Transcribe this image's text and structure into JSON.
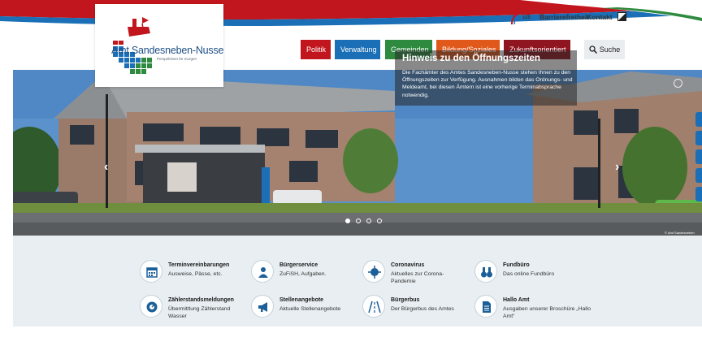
{
  "header": {
    "logo": {
      "name": "Amt Sandesneben-Nusse",
      "tagline": "Perspektiven für morgen"
    },
    "utility": {
      "counter": "115",
      "accessibility": "Barrierefreiheit",
      "contact": "Kontakt"
    },
    "nav": [
      {
        "label": "Politik",
        "color": "#c2161e"
      },
      {
        "label": "Verwaltung",
        "color": "#1b6fb6"
      },
      {
        "label": "Gemeinden",
        "color": "#2e8a3f"
      },
      {
        "label": "Bildung/Soziales",
        "color": "#e1581b"
      },
      {
        "label": "Zukunftsorientiert",
        "color": "#8f1520"
      }
    ],
    "search_label": "Suche"
  },
  "hero": {
    "title": "Hinweis zu den Öffnungszeiten",
    "text": "Die Fachämter des Amtes Sandesneben-Nusse stehen Ihnen zu den Öffnungszeiten zur Verfügung. Ausnahmen bilden das Ordnungs- und Meldeamt, bei diesen Ämtern ist eine vorherige Terminabsprache notwendig.",
    "slides": 4,
    "active_slide": 1,
    "copyright": "© Amt Sandesneben"
  },
  "quick_links": [
    {
      "title": "Terminvereinbarungen",
      "sub": "Ausweise, Pässe, etc.",
      "icon": "calendar-icon"
    },
    {
      "title": "Bürgerservice",
      "sub": "ZuFiSH, Aufgaben.",
      "icon": "people-icon"
    },
    {
      "title": "Coronavirus",
      "sub": "Aktuelles zur Corona-Pandemie",
      "icon": "virus-icon"
    },
    {
      "title": "Fundbüro",
      "sub": "Das online Fundbüro",
      "icon": "binoculars-icon"
    },
    {
      "title": "Zählerstandsmeldungen",
      "sub": "Übermittlung Zählerstand Wasser",
      "icon": "meter-icon"
    },
    {
      "title": "Stellenangebote",
      "sub": "Aktuelle Stellenangebote",
      "icon": "megaphone-icon"
    },
    {
      "title": "Bürgerbus",
      "sub": "Der Bürgerbus des Amtes",
      "icon": "road-icon"
    },
    {
      "title": "Hallo Amt",
      "sub": "Ausgaben unserer Broschüre „Hallo Amt“",
      "icon": "document-icon"
    }
  ]
}
